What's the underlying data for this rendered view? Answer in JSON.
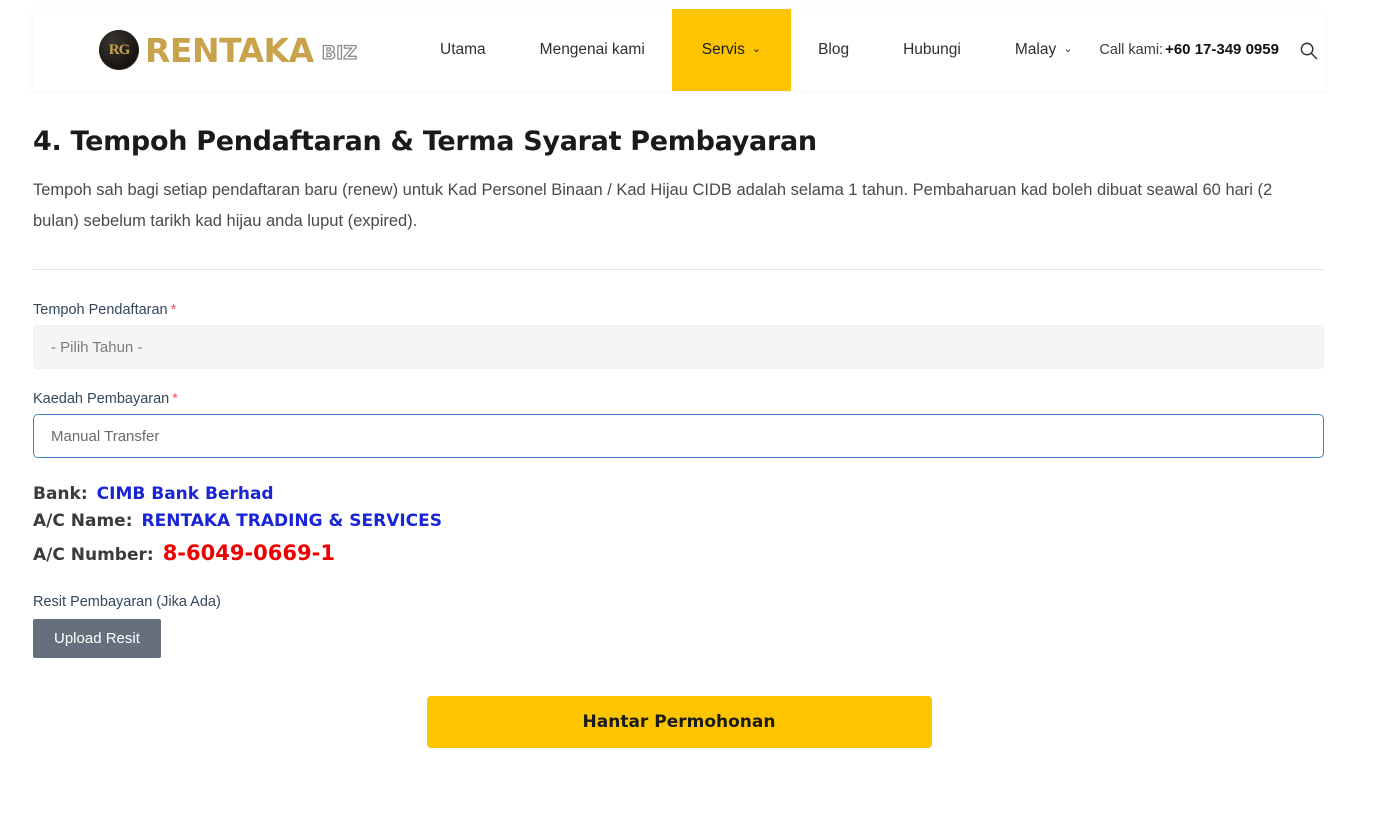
{
  "header": {
    "logo": {
      "monogram": "RG",
      "brand_main": "RENTAKA",
      "brand_sub": "BIZ",
      "brand_color": "#c8a34b"
    },
    "nav": [
      {
        "label": "Utama",
        "active": false,
        "has_caret": false
      },
      {
        "label": "Mengenai kami",
        "active": false,
        "has_caret": false
      },
      {
        "label": "Servis",
        "active": true,
        "has_caret": true,
        "caret": "⌄"
      },
      {
        "label": "Blog",
        "active": false,
        "has_caret": false
      },
      {
        "label": "Hubungi",
        "active": false,
        "has_caret": false
      },
      {
        "label": "Malay",
        "active": false,
        "has_caret": true,
        "caret": "⌄"
      }
    ],
    "call_label": "Call kami:",
    "call_number": "+60 17-349 0959",
    "search_icon": "search-icon",
    "active_color": "#fdc500"
  },
  "main": {
    "title": "4. Tempoh Pendaftaran & Terma Syarat Pembayaran",
    "body": "Tempoh sah bagi setiap pendaftaran baru (renew) untuk Kad Personel Binaan / Kad Hijau CIDB adalah selama 1 tahun. Pembaharuan kad boleh dibuat seawal 60 hari (2 bulan) sebelum tarikh kad hijau anda luput (expired)."
  },
  "form": {
    "tempoh": {
      "label": "Tempoh Pendaftaran",
      "required_marker": "*",
      "value": "- Pilih Tahun -"
    },
    "kaedah": {
      "label": "Kaedah Pembayaran",
      "required_marker": "*",
      "value": "Manual Transfer"
    },
    "bank": [
      {
        "key": "Bank:",
        "value": "CIMB Bank Berhad"
      },
      {
        "key": "A/C Name:",
        "value": "RENTAKA TRADING & SERVICES"
      }
    ],
    "account_number": {
      "key": "A/C Number:",
      "value": "8-6049-0669-1"
    },
    "upload": {
      "label": "Resit Pembayaran (Jika Ada)",
      "button": "Upload Resit"
    },
    "submit_label": "Hantar Permohonan"
  },
  "colors": {
    "accent_yellow": "#fdc500",
    "link_blue": "#1a25d6",
    "alert_red": "#ef0000",
    "upload_gray": "#66707d",
    "focus_border": "#3d82c4"
  }
}
